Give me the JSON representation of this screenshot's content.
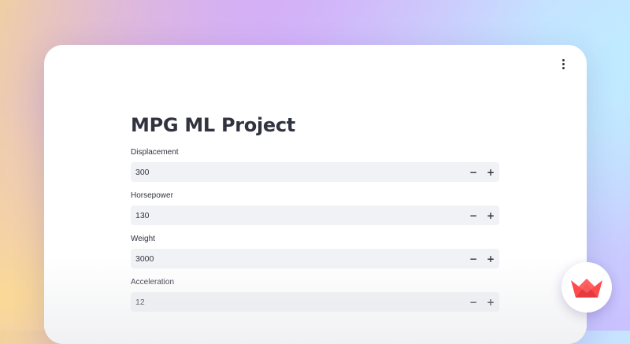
{
  "app": {
    "title": "MPG ML Project",
    "menu_icon": "kebab-menu-icon",
    "brand_icon": "streamlit-crown-icon"
  },
  "colors": {
    "text": "#31333f",
    "input_bg": "#f0f2f6",
    "brand_red": "#ff4b4b"
  },
  "fields": [
    {
      "label": "Displacement",
      "value": "300",
      "decrement": "−",
      "increment": "+"
    },
    {
      "label": "Horsepower",
      "value": "130",
      "decrement": "−",
      "increment": "+"
    },
    {
      "label": "Weight",
      "value": "3000",
      "decrement": "−",
      "increment": "+"
    },
    {
      "label": "Acceleration",
      "value": "12",
      "decrement": "−",
      "increment": "+"
    }
  ]
}
